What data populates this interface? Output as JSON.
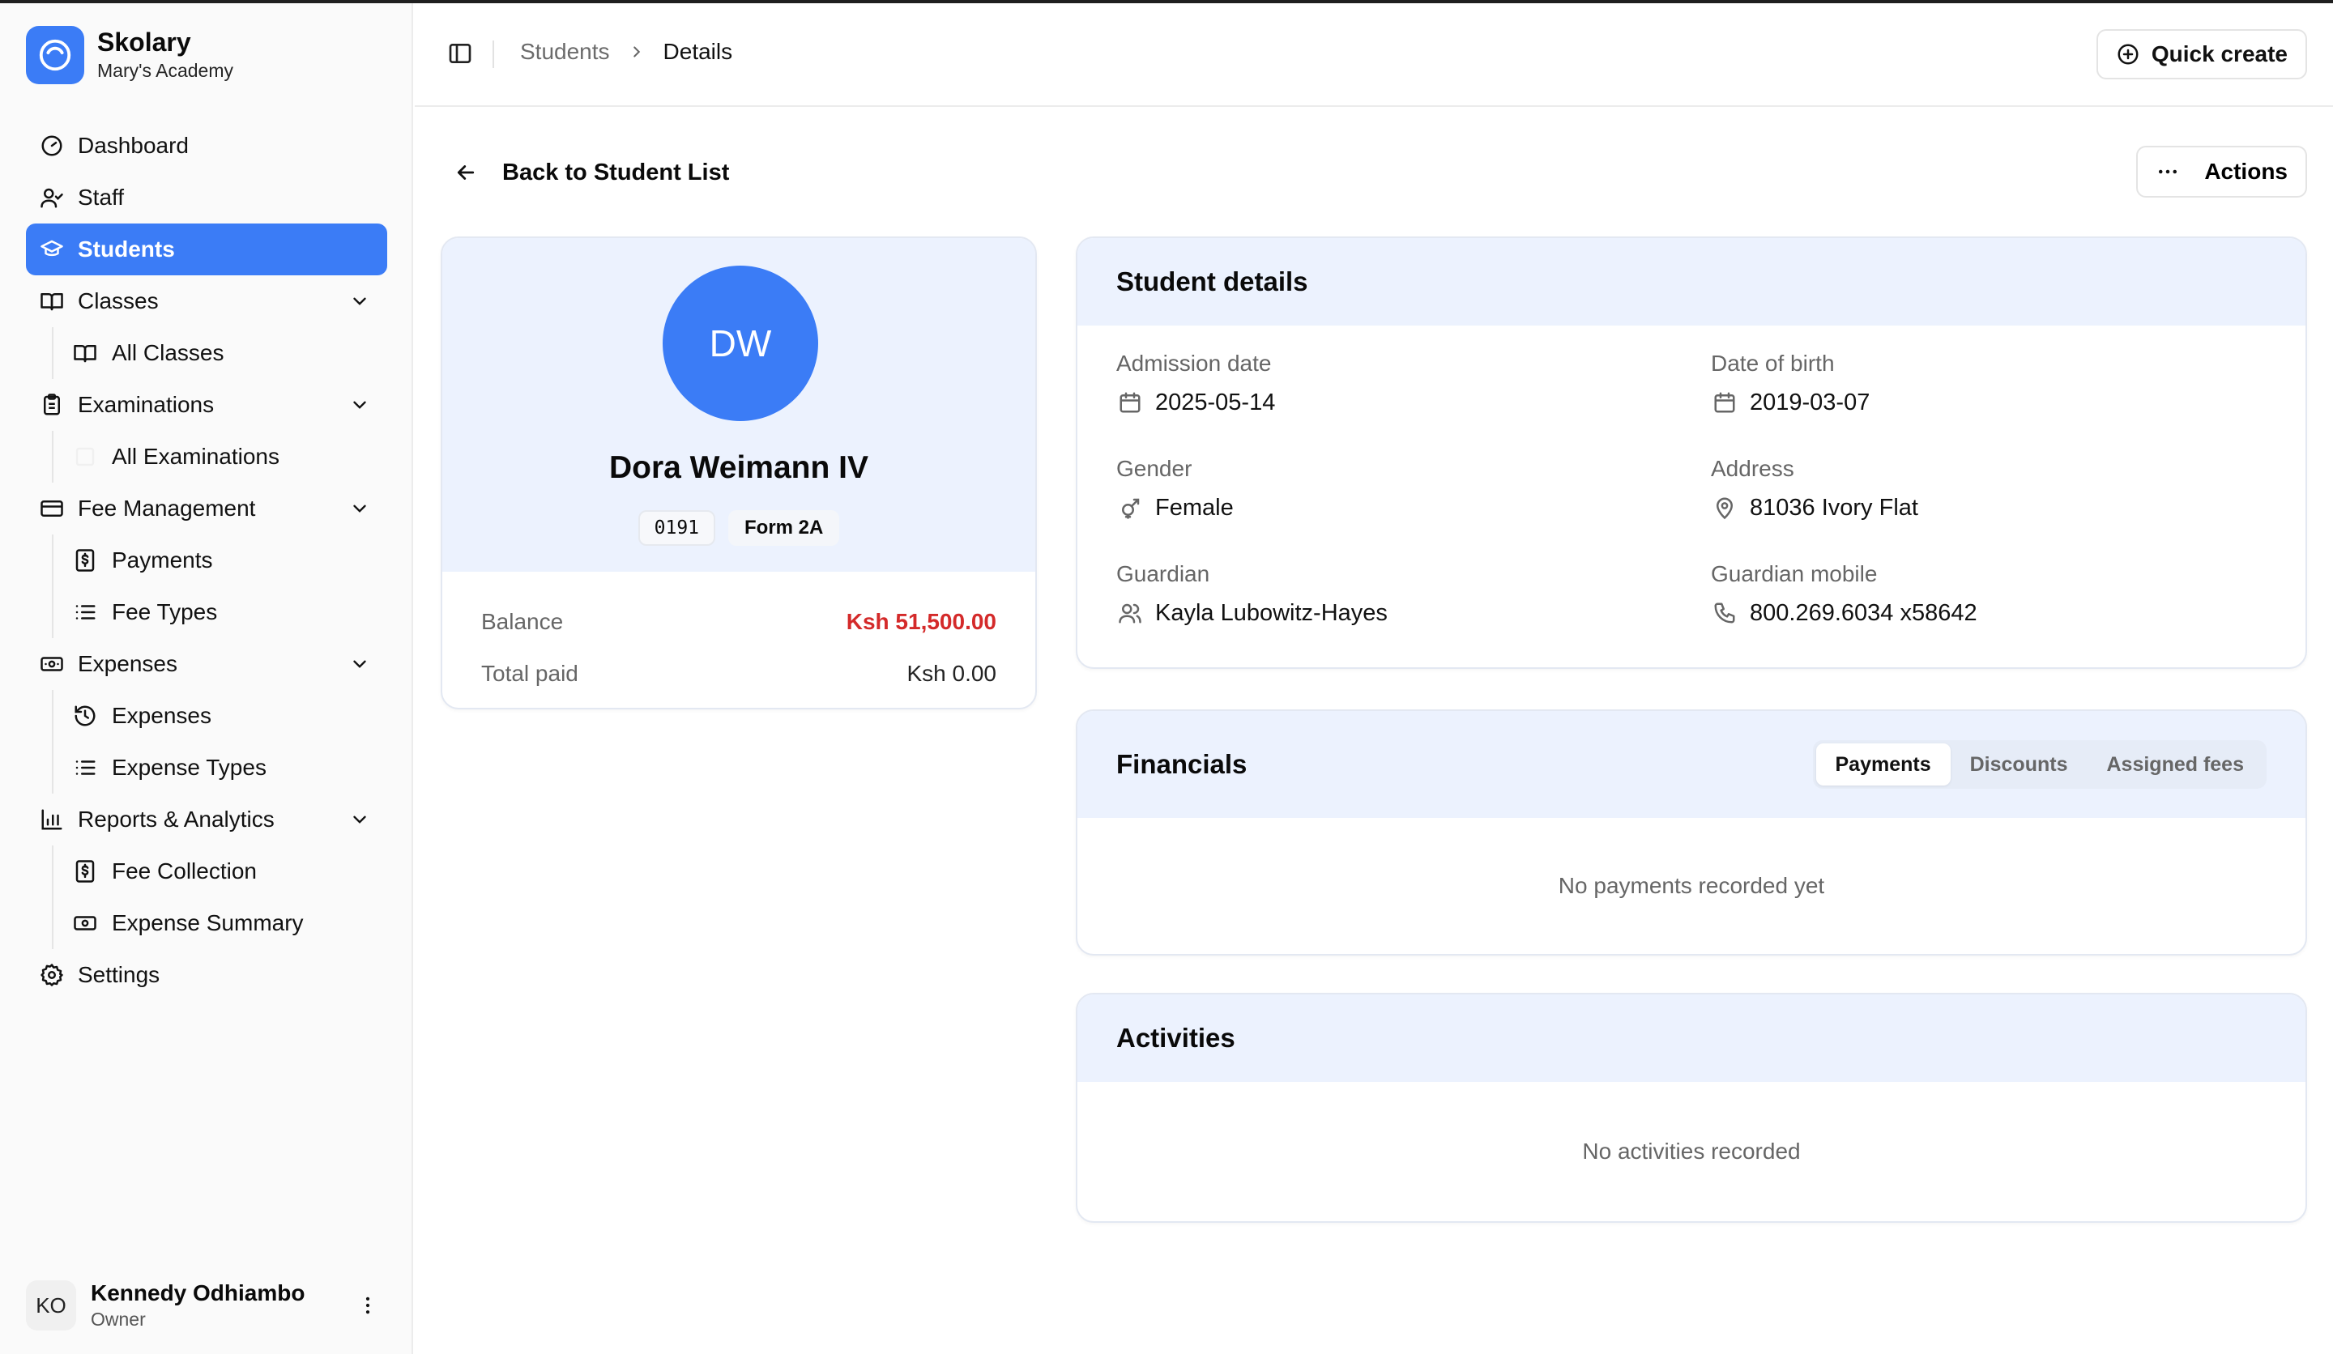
{
  "brand": {
    "name": "Skolary",
    "school": "Mary's Academy",
    "accent": "#3b7cf6"
  },
  "nav": {
    "dashboard": "Dashboard",
    "staff": "Staff",
    "students": "Students",
    "classes": "Classes",
    "all_classes": "All Classes",
    "examinations": "Examinations",
    "all_examinations": "All Examinations",
    "fee_management": "Fee Management",
    "payments": "Payments",
    "fee_types": "Fee Types",
    "expenses": "Expenses",
    "expenses_sub": "Expenses",
    "expense_types": "Expense Types",
    "reports": "Reports & Analytics",
    "fee_collection": "Fee Collection",
    "expense_summary": "Expense Summary",
    "settings": "Settings"
  },
  "user": {
    "initials": "KO",
    "name": "Kennedy Odhiambo",
    "role": "Owner"
  },
  "header": {
    "breadcrumb_parent": "Students",
    "breadcrumb_current": "Details",
    "quick_create": "Quick create"
  },
  "main": {
    "back_label": "Back to Student List",
    "actions_label": "Actions"
  },
  "profile": {
    "initials": "DW",
    "name": "Dora Weimann IV",
    "id": "0191",
    "form": "Form 2A",
    "balance_label": "Balance",
    "balance_value": "Ksh 51,500.00",
    "paid_label": "Total paid",
    "paid_value": "Ksh 0.00"
  },
  "details": {
    "title": "Student details",
    "admission_label": "Admission date",
    "admission_value": "2025-05-14",
    "dob_label": "Date of birth",
    "dob_value": "2019-03-07",
    "gender_label": "Gender",
    "gender_value": "Female",
    "address_label": "Address",
    "address_value": "81036 Ivory Flat",
    "guardian_label": "Guardian",
    "guardian_value": "Kayla Lubowitz-Hayes",
    "mobile_label": "Guardian mobile",
    "mobile_value": "800.269.6034 x58642"
  },
  "financials": {
    "title": "Financials",
    "tabs": [
      "Payments",
      "Discounts",
      "Assigned fees"
    ],
    "active_tab": "Payments",
    "empty": "No payments recorded yet"
  },
  "activities": {
    "title": "Activities",
    "empty": "No activities recorded"
  },
  "icons": {
    "brand": "circle-logo-icon",
    "dashboard": "gauge-icon",
    "staff": "user-check-icon",
    "students": "graduation-cap-icon",
    "classes": "book-open-icon",
    "examinations": "clipboard-icon",
    "fees": "credit-card-icon",
    "expenses": "banknote-icon",
    "reports": "bar-chart-icon",
    "settings": "gear-icon"
  }
}
